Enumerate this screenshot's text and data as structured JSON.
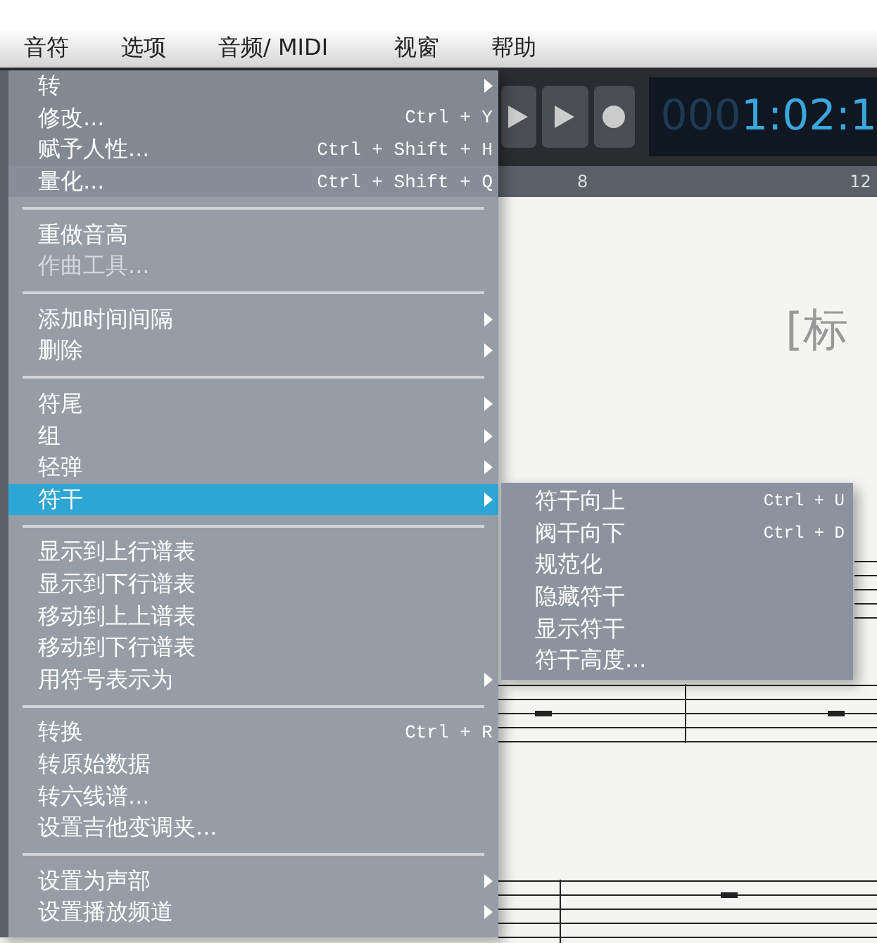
{
  "menubar": [
    {
      "label": "音符"
    },
    {
      "label": "选项"
    },
    {
      "label": "音频/ MIDI"
    },
    {
      "label": "视窗"
    },
    {
      "label": "帮助"
    }
  ],
  "toolbar": {
    "time_dim": "000",
    "time_bright": "1:02:1"
  },
  "ruler": [
    "8",
    "12"
  ],
  "score": {
    "title": "[标"
  },
  "menu": {
    "groups": [
      [
        {
          "label": "转",
          "submenu": true,
          "disabled": false,
          "selected": false
        },
        {
          "label": "修改...",
          "shortcut": "Ctrl + Y",
          "submenu": false,
          "disabled": false,
          "selected": false
        },
        {
          "label": "赋予人性...",
          "shortcut": "Ctrl + Shift + H",
          "submenu": false,
          "disabled": false,
          "selected": false
        },
        {
          "label": "量化...",
          "shortcut": "Ctrl + Shift + Q",
          "submenu": false,
          "disabled": false,
          "selected": false
        }
      ],
      [
        {
          "label": "重做音高",
          "submenu": false,
          "disabled": false,
          "selected": false
        },
        {
          "label": "作曲工具...",
          "submenu": false,
          "disabled": true,
          "selected": false
        }
      ],
      [
        {
          "label": "添加时间间隔",
          "submenu": true,
          "disabled": false,
          "selected": false
        },
        {
          "label": "删除",
          "submenu": true,
          "disabled": false,
          "selected": false
        }
      ],
      [
        {
          "label": "符尾",
          "submenu": true,
          "disabled": false,
          "selected": false
        },
        {
          "label": "组",
          "submenu": true,
          "disabled": false,
          "selected": false
        },
        {
          "label": "轻弹",
          "submenu": true,
          "disabled": false,
          "selected": false
        },
        {
          "label": "符干",
          "submenu": true,
          "disabled": false,
          "selected": true
        }
      ],
      [
        {
          "label": "显示到上行谱表",
          "submenu": false,
          "disabled": false,
          "selected": false
        },
        {
          "label": "显示到下行谱表",
          "submenu": false,
          "disabled": false,
          "selected": false
        },
        {
          "label": "移动到上上谱表",
          "submenu": false,
          "disabled": false,
          "selected": false
        },
        {
          "label": "移动到下行谱表",
          "submenu": false,
          "disabled": false,
          "selected": false
        },
        {
          "label": "用符号表示为",
          "submenu": true,
          "disabled": false,
          "selected": false
        }
      ],
      [
        {
          "label": "转换",
          "shortcut": "Ctrl + R",
          "submenu": false,
          "disabled": false,
          "selected": false
        },
        {
          "label": "转原始数据",
          "submenu": false,
          "disabled": false,
          "selected": false
        },
        {
          "label": "转六线谱...",
          "submenu": false,
          "disabled": false,
          "selected": false
        },
        {
          "label": "设置吉他变调夹...",
          "submenu": false,
          "disabled": false,
          "selected": false
        }
      ],
      [
        {
          "label": "设置为声部",
          "submenu": true,
          "disabled": false,
          "selected": false
        },
        {
          "label": "设置播放频道",
          "submenu": true,
          "disabled": false,
          "selected": false
        }
      ]
    ]
  },
  "submenu": {
    "items": [
      {
        "label": "符干向上",
        "shortcut": "Ctrl + U"
      },
      {
        "label": "阀干向下",
        "shortcut": "Ctrl + D"
      },
      {
        "label": "规范化"
      },
      {
        "label": "隐藏符干"
      },
      {
        "label": "显示符干"
      },
      {
        "label": "符干高度..."
      }
    ]
  }
}
